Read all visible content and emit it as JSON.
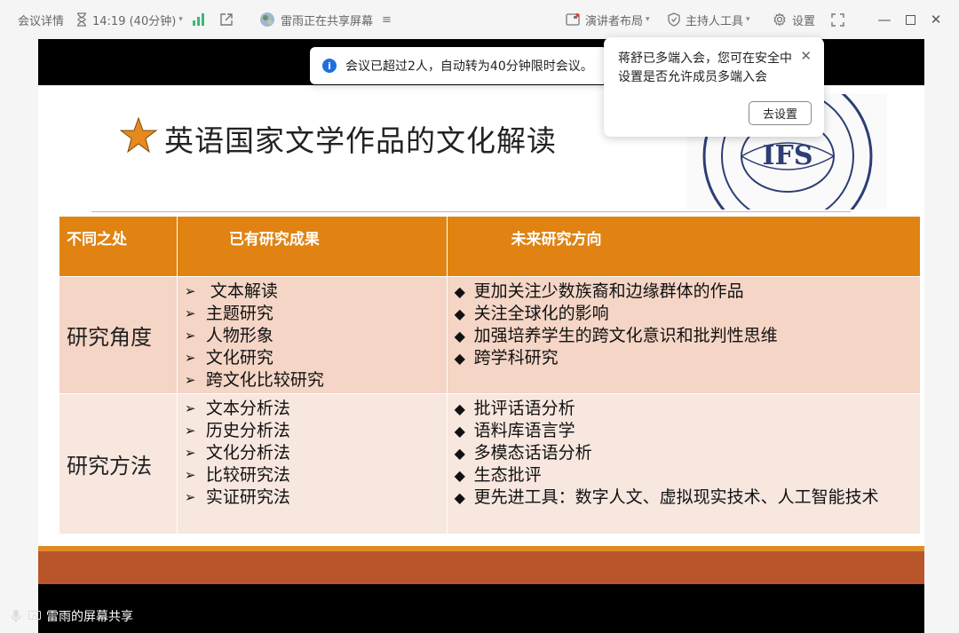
{
  "titlebar": {
    "meeting_details": "会议详情",
    "time": "14:19 (40分钟)",
    "sharing_status": "雷雨正在共享屏幕",
    "presenter_layout": "演讲者布局",
    "host_tools": "主持人工具",
    "settings": "设置"
  },
  "toast": {
    "text": "会议已超过2人，自动转为40分钟限时会议。"
  },
  "popup": {
    "text": "蒋舒已多端入会，您可在安全中设置是否允许成员多端入会",
    "button": "去设置"
  },
  "slide": {
    "title": "英语国家文学作品的文化解读",
    "logo_text": "IFS",
    "table": {
      "headers": [
        "不同之处",
        "已有研究成果",
        "未来研究方向"
      ],
      "rows": [
        {
          "label": "研究角度",
          "existing": [
            "文本解读",
            "主题研究",
            "人物形象",
            "文化研究",
            "跨文化比较研究"
          ],
          "future": [
            "更加关注少数族裔和边缘群体的作品",
            "关注全球化的影响",
            "加强培养学生的跨文化意识和批判性思维",
            "跨学科研究"
          ]
        },
        {
          "label": "研究方法",
          "existing": [
            "文本分析法",
            "历史分析法",
            "文化分析法",
            "比较研究法",
            "实证研究法"
          ],
          "future": [
            "批评话语分析",
            "语料库语言学",
            "多模态话语分析",
            "生态批评",
            "更先进工具：数字人文、虚拟现实技术、人工智能技术"
          ]
        }
      ]
    }
  },
  "footer": {
    "share_label": "雷雨的屏幕共享"
  },
  "colors": {
    "header_orange": "#e08312",
    "row1_bg": "#f4d5c6",
    "row2_bg": "#f7e7df",
    "band_rust": "#b9552b",
    "info_blue": "#1f6fe0"
  }
}
